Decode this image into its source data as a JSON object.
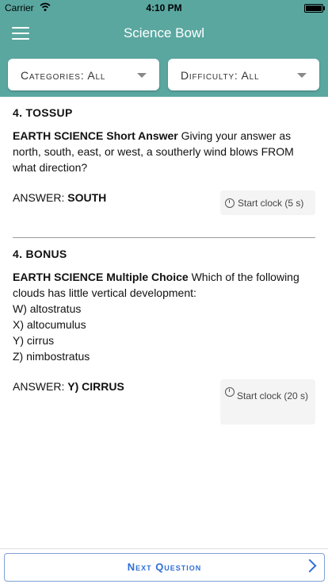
{
  "status_bar": {
    "carrier": "Carrier",
    "time": "4:10 PM"
  },
  "nav": {
    "title": "Science Bowl",
    "menu_icon": "hamburger-menu-icon"
  },
  "filters": {
    "categories_label": "Categories: All",
    "difficulty_label": "Difficulty: All"
  },
  "tossup": {
    "heading": "4. TOSSUP",
    "category": "EARTH SCIENCE Short Answer",
    "text": " Giving your answer as north, south, east, or west, a southerly wind blows FROM what direction?",
    "answer_prefix": "ANSWER: ",
    "answer": "SOUTH",
    "clock_label": "Start clock (5 s)"
  },
  "bonus": {
    "heading": "4. BONUS",
    "category": "EARTH SCIENCE Multiple Choice",
    "text": " Which of the following clouds has little vertical development:",
    "choices": [
      "W) altostratus",
      "X) altocumulus",
      "Y) cirrus",
      "Z) nimbostratus"
    ],
    "answer_prefix": "ANSWER: ",
    "answer": "Y) CIRRUS",
    "clock_label": "Start clock (20 s)"
  },
  "footer": {
    "next_label": "Next Question"
  },
  "colors": {
    "header": "#5aa7a0",
    "accent": "#2e6fd6"
  }
}
